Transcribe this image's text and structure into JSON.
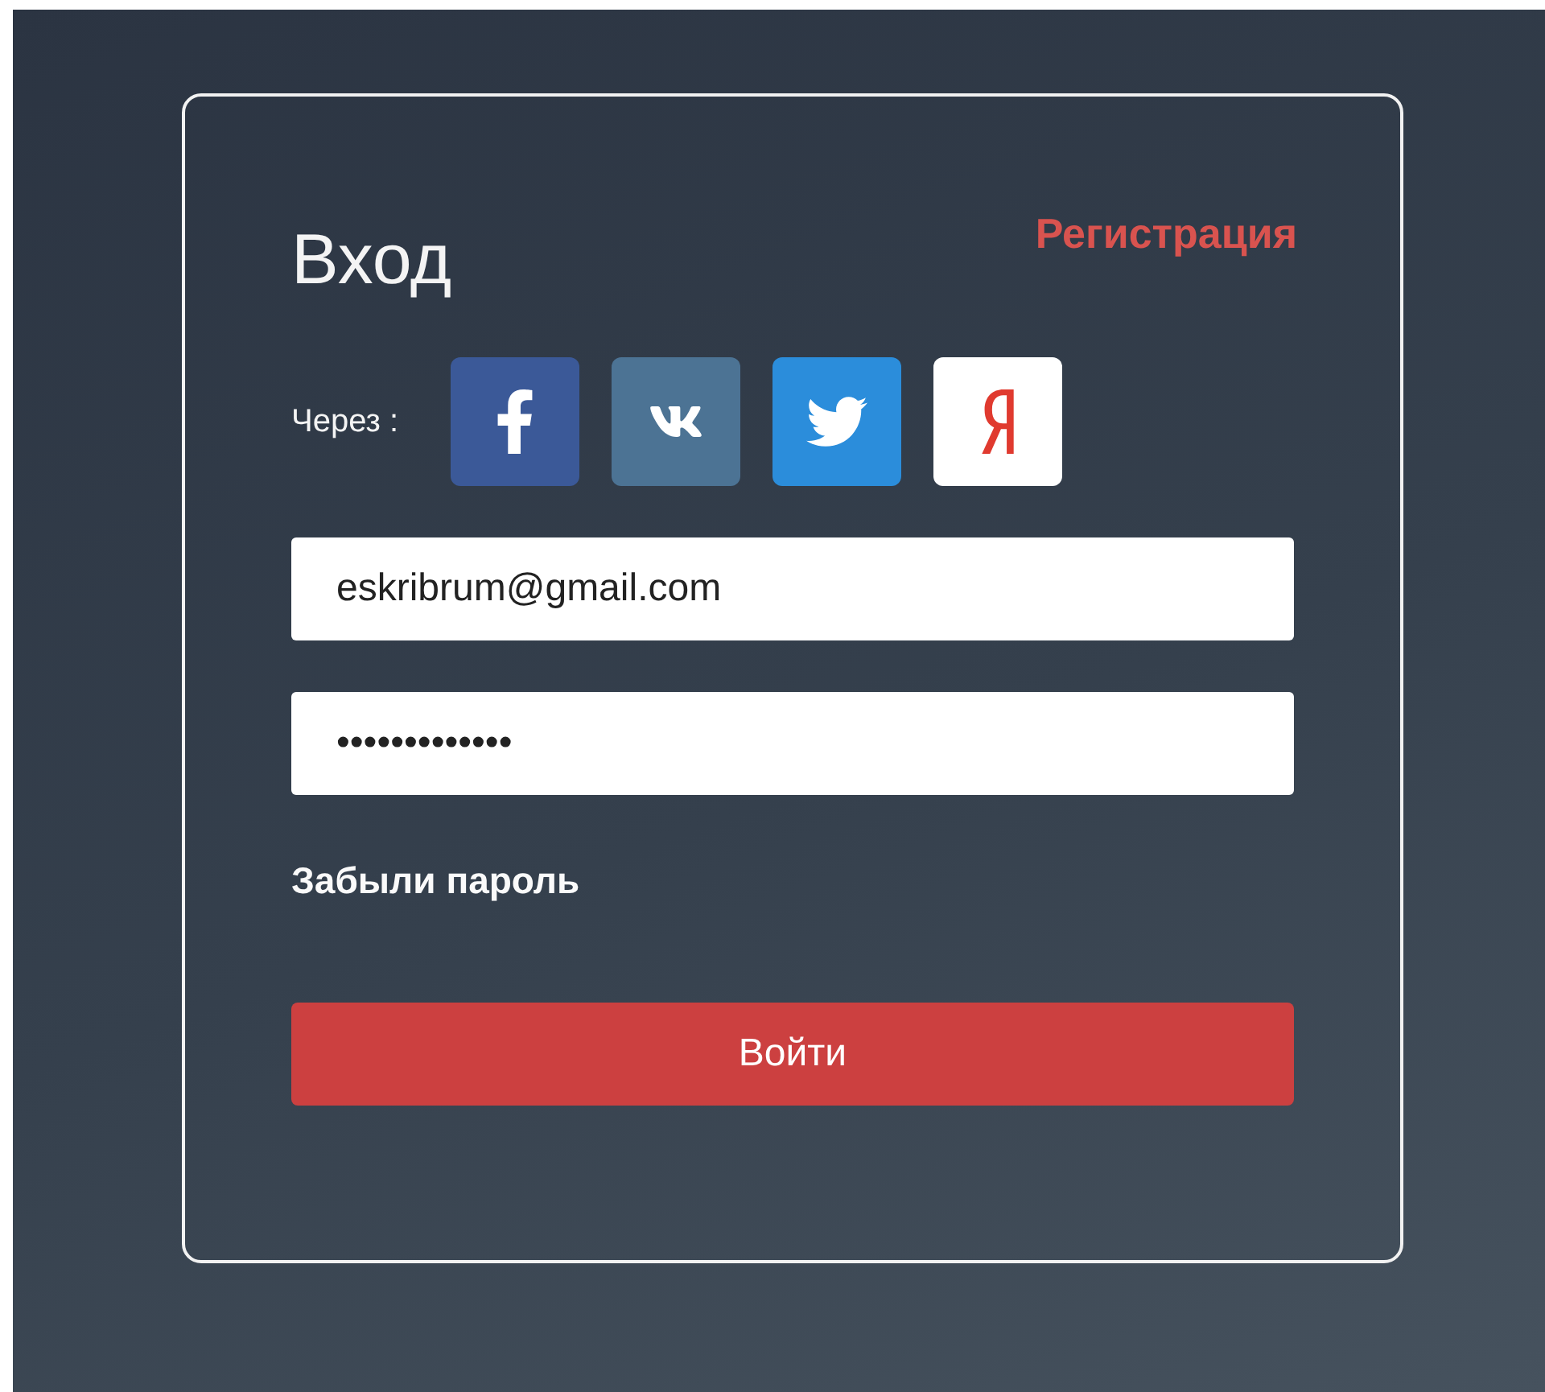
{
  "login": {
    "title": "Вход",
    "register_link": "Регистрация",
    "via_label": "Через :",
    "social": [
      {
        "kind": "facebook",
        "color": "#3b5998"
      },
      {
        "kind": "vk",
        "color": "#4c7394"
      },
      {
        "kind": "twitter",
        "color": "#2b8ddb"
      },
      {
        "kind": "yandex",
        "color": "#ffffff"
      }
    ],
    "email": {
      "value": "eskribrum@gmail.com"
    },
    "password": {
      "value": "•••••••••••••"
    },
    "forgot_link": "Забыли пароль",
    "submit": "Войти"
  }
}
